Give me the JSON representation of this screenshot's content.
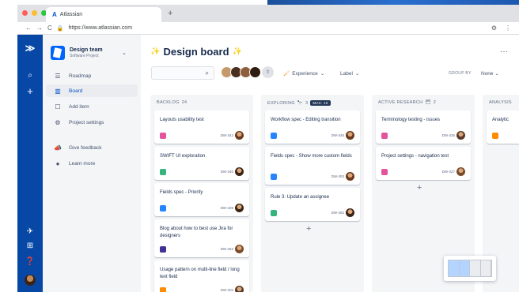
{
  "browser": {
    "tab_title": "Atlassian",
    "tab_logo": "A",
    "new_tab": "+",
    "url": "https://www.atlassian.com",
    "traffic_colors": [
      "#ff5f57",
      "#febc2e",
      "#28c840"
    ]
  },
  "global_nav": {
    "icons": [
      "jira-logo-icon",
      "search-icon",
      "create-icon",
      "pin-icon",
      "apps-icon",
      "help-icon",
      "profile-avatar"
    ]
  },
  "sidebar": {
    "project_name": "Design team",
    "project_type": "Software Project",
    "items": [
      {
        "label": "Roadmap",
        "icon": "roadmap-icon",
        "active": false
      },
      {
        "label": "Board",
        "icon": "board-icon",
        "active": true
      },
      {
        "label": "Add item",
        "icon": "add-item-icon",
        "active": false
      },
      {
        "label": "Project settings",
        "icon": "gear-icon",
        "active": false
      },
      {
        "label": "Give feedback",
        "icon": "megaphone-icon",
        "active": false
      },
      {
        "label": "Learn more",
        "icon": "info-icon",
        "active": false
      }
    ]
  },
  "board": {
    "title": "Design board",
    "search_placeholder": "",
    "filters": {
      "experience": "Experience",
      "label": "Label"
    },
    "group_by_label": "GROUP BY",
    "group_by_value": "None",
    "more": "···"
  },
  "columns": [
    {
      "name": "BACKLOG",
      "count": "24",
      "cards": [
        {
          "title": "Layouts usability test",
          "key": "DW-342",
          "type_color": "#e2549c",
          "avatar": "#6b3a1f"
        },
        {
          "title": "SWIFT UI exploration",
          "key": "DW-340",
          "type_color": "#36b37e",
          "avatar": "#3b2416"
        },
        {
          "title": "Fields spec - Priority",
          "key": "DW-339",
          "type_color": "#2684ff",
          "avatar": "#3b2416"
        },
        {
          "title": "Blog about how to best use Jira for designers",
          "key": "DW-262",
          "type_color": "#403294",
          "avatar": "#7a4a2a"
        },
        {
          "title": "Usage pattern on multi-line field / long text field",
          "key": "DW-202",
          "type_color": "#ff8b00",
          "avatar": "#5a3a28"
        }
      ]
    },
    {
      "name": "EXPLORING",
      "emoji": "🔭",
      "count": "3",
      "max": "MAX: 10",
      "cards": [
        {
          "title": "Workflow spec - Editing transition",
          "key": "DW-345",
          "type_color": "#2684ff",
          "avatar": "#6b3a1f"
        },
        {
          "title": "Fields spec - Show more custom fields",
          "key": "DW-300",
          "type_color": "#2684ff",
          "avatar": "#6b3a1f"
        },
        {
          "title": "Rule 3: Update an assignee",
          "key": "DW-282",
          "type_color": "#36b37e",
          "avatar": "#3b2416"
        }
      ]
    },
    {
      "name": "ACTIVE RESEARCH",
      "emoji": "🗂",
      "count": "2",
      "cards": [
        {
          "title": "Terminology testing - issues",
          "key": "DW-326",
          "type_color": "#e2549c",
          "avatar": "#5a3a28"
        },
        {
          "title": "Project settings - navigation test",
          "key": "DW-327",
          "type_color": "#e2549c",
          "avatar": "#7a4a2a"
        }
      ]
    },
    {
      "name": "ANALYSIS",
      "cards": [
        {
          "title": "Analytic",
          "key": "",
          "type_color": "#ff8b00",
          "avatar": ""
        }
      ]
    }
  ],
  "add_card": "+",
  "colors": {
    "global_nav": "#0747a6",
    "sidebar_bg": "#f4f5f7",
    "accent": "#0052cc",
    "column_bg": "#f4f5f7"
  }
}
